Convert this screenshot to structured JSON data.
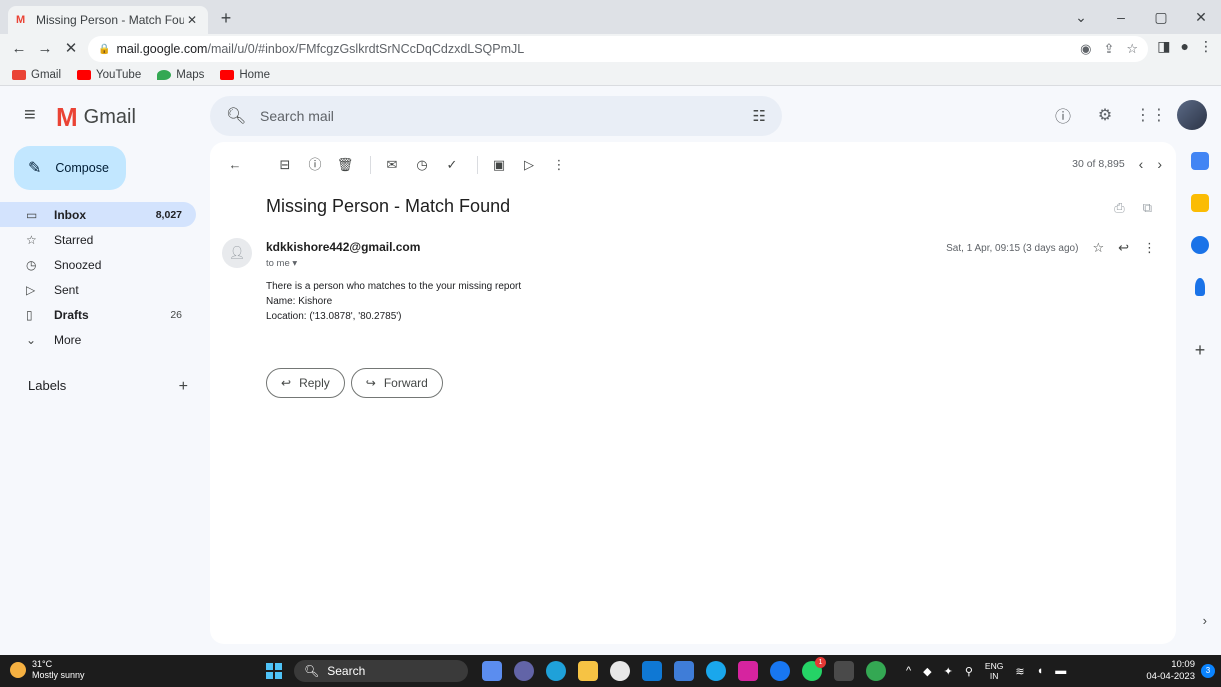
{
  "browser": {
    "tab_title": "Missing Person - Match Found - ",
    "url_host": "mail.google.com",
    "url_path": "/mail/u/0/#inbox/FMfcgzGslkrdtSrNCcDqCdzxdLSQPmJL",
    "bookmarks": [
      {
        "label": "Gmail",
        "color": "#ea4335"
      },
      {
        "label": "YouTube",
        "color": "#ff0000"
      },
      {
        "label": "Maps",
        "color": "#34a853"
      },
      {
        "label": "Home",
        "color": "#ff0000"
      }
    ]
  },
  "gmail": {
    "logo_text": "Gmail",
    "search_placeholder": "Search mail",
    "compose_label": "Compose",
    "nav": [
      {
        "label": "Inbox",
        "count": "8,027",
        "icon": "inbox-icon"
      },
      {
        "label": "Starred",
        "count": "",
        "icon": "star-icon"
      },
      {
        "label": "Snoozed",
        "count": "",
        "icon": "clock-icon"
      },
      {
        "label": "Sent",
        "count": "",
        "icon": "send-icon"
      },
      {
        "label": "Drafts",
        "count": "26",
        "icon": "draft-icon"
      },
      {
        "label": "More",
        "count": "",
        "icon": "chevron-down-icon"
      }
    ],
    "labels_heading": "Labels",
    "pager": "30 of 8,895",
    "subject": "Missing Person - Match Found",
    "sender": "kdkkishore442@gmail.com",
    "to_line": "to me",
    "date": "Sat, 1 Apr, 09:15 (3 days ago)",
    "body_lines": [
      "There is a person who matches to the your missing report",
      "Name: Kishore",
      "Location: ('13.0878', '80.2785')"
    ],
    "reply_label": "Reply",
    "forward_label": "Forward"
  },
  "taskbar": {
    "temp": "31°C",
    "weather": "Mostly sunny",
    "search_label": "Search",
    "lang_line1": "ENG",
    "lang_line2": "IN",
    "time": "10:09",
    "date": "04-04-2023",
    "notif_count": "3",
    "whatsapp_badge": "1"
  },
  "colors": {
    "accent_blue": "#0b57d0",
    "compose_bg": "#c2e7ff",
    "active_nav": "#d3e3fd"
  }
}
